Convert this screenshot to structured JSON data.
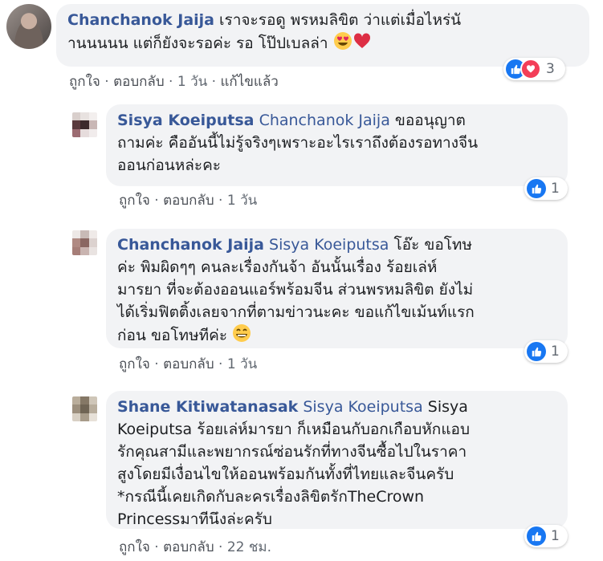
{
  "comments": [
    {
      "author": "Chanchanok Jaija",
      "mention": "",
      "text_line1": "เราจะรอดู พรหมลิขิต ว่าแต่เมื่อไหร่นั",
      "text_line2": "านนนนน แต่ก็ยังจะรอค่ะ รอ โป๊ปเบลล่า",
      "like_label": "ถูกใจ",
      "reply_label": "ตอบกลับ",
      "time": "1 วัน",
      "edited": "แก้ไขแล้ว",
      "reaction_count": "3"
    },
    {
      "author": "Sisya Koeiputsa",
      "mention": "Chanchanok Jaija",
      "text_line1": "ขออนุญาต",
      "text_line2": "ถามค่ะ คืออันนี้ไม่รู้จริงๆเพราะอะไรเราถึงต้องรอทางจีน",
      "text_line3": "ออนก่อนหล่ะคะ",
      "like_label": "ถูกใจ",
      "reply_label": "ตอบกลับ",
      "time": "1 วัน",
      "reaction_count": "1"
    },
    {
      "author": "Chanchanok Jaija",
      "mention": "Sisya Koeiputsa",
      "text_line1": "โอ๊ะ ขอโทษ",
      "text_line2": "ค่ะ พิมผิดๆๆ คนละเรื่องกันจ้า อันนั้นเรื่อง ร้อยเล่ห์",
      "text_line3": "มารยา ที่จะต้องออนแอร์พร้อมจีน ส่วนพรหมลิขิต ยังไม่",
      "text_line4": "ได้เริ่มฟิตติ้งเลยจากที่ตามข่าวนะคะ ขอแก้ไขเม้นท์แรก",
      "text_line5": "ก่อน ขอโทษทีค่ะ",
      "like_label": "ถูกใจ",
      "reply_label": "ตอบกลับ",
      "time": "1 วัน",
      "reaction_count": "1"
    },
    {
      "author": "Shane Kitiwatanasak",
      "mention": "Sisya Koeiputsa",
      "text_line1": "Sisya",
      "text_line2": "Koeiputsa ร้อยเล่ห์มารยา ก็เหมือนกับอกเกือบหักแอบ",
      "text_line3": "รักคุณสามีและพยากรณ์ซ่อนรักที่ทางจีนซื้อไปในราคา",
      "text_line4": "สูงโดยมีเงื่อนไขให้ออนพร้อมกันทั้งที่ไทยและจีนครับ",
      "text_line5": "*กรณีนี้เคยเกิดกับละครเรื่องลิขิตรักTheCrown",
      "text_line6": "Princessมาทีนึงล่ะครับ",
      "like_label": "ถูกใจ",
      "reply_label": "ตอบกลับ",
      "time": "22 ชม.",
      "reaction_count": "1"
    }
  ],
  "colors": {
    "author": "#385898",
    "bubble": "#f2f3f5",
    "like": "#1877f2",
    "love": "#f33e58"
  },
  "icons": [
    "like-reaction-icon",
    "love-reaction-icon",
    "heart-eyes-emoji",
    "red-heart-emoji",
    "grinning-emoji"
  ]
}
